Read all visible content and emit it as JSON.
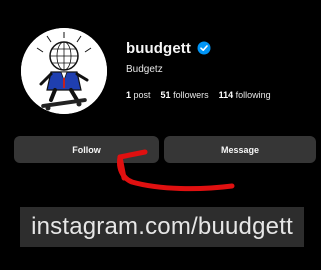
{
  "profile": {
    "username": "buudgett",
    "full_name": "Budgetz",
    "verified": true,
    "avatar_icon": "disco-ball-skater-avatar",
    "stats": {
      "posts_count": "1",
      "posts_label": "post",
      "followers_count": "51",
      "followers_label": "followers",
      "following_count": "114",
      "following_label": "following"
    }
  },
  "actions": {
    "follow_label": "Follow",
    "message_label": "Message"
  },
  "overlay": {
    "url_text": "instagram.com/buudgett",
    "arrow_color": "#e01010"
  },
  "colors": {
    "background": "#000000",
    "button": "#363636",
    "verified": "#0095f6",
    "banner": "#2d2d2d"
  }
}
